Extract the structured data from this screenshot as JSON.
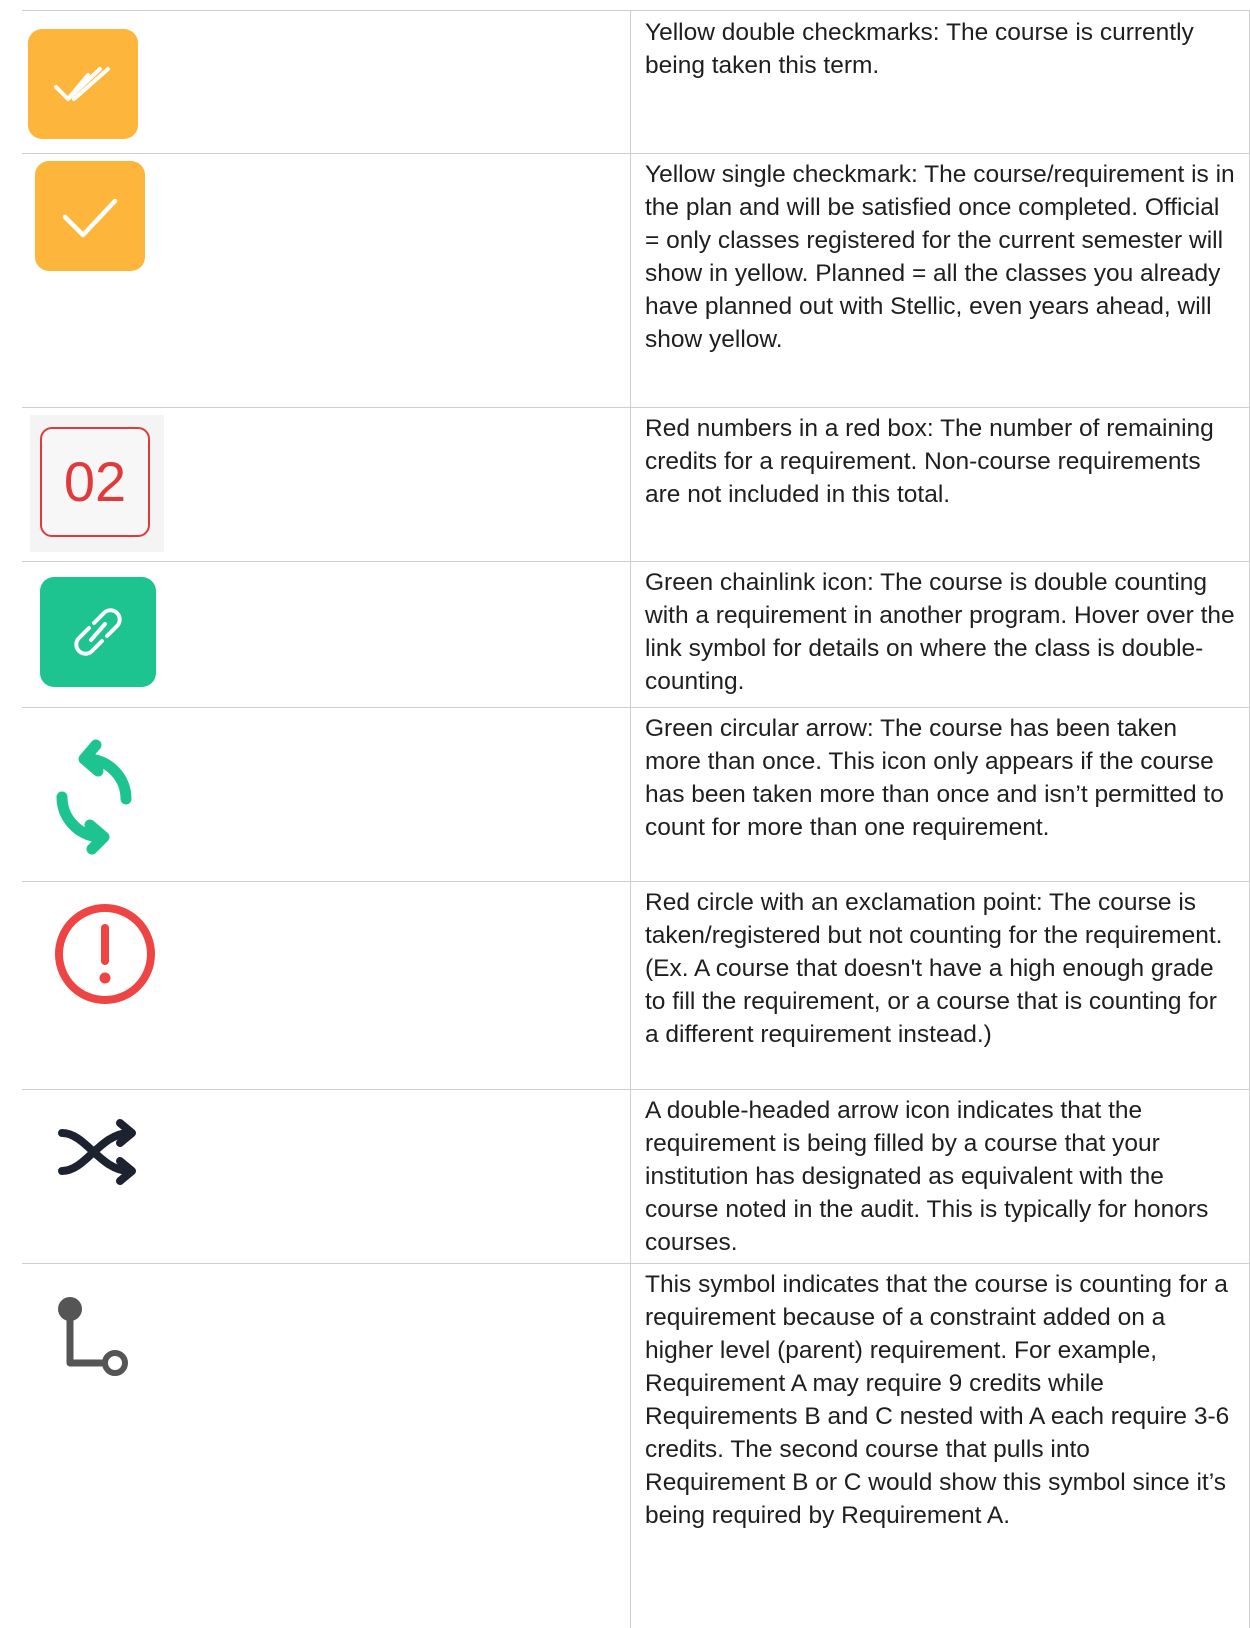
{
  "legend": {
    "rows": [
      {
        "icon": "double-check-icon",
        "color": "#FDB63B",
        "text": "Yellow double checkmarks: The course is currently being taken this term."
      },
      {
        "icon": "check-icon",
        "color": "#FDB63B",
        "text": "Yellow single checkmark: The course/requirement is in the plan and will be satisfied once completed. Official = only classes registered for the current semester will show in yellow. Planned = all the classes you already have planned out with Stellic, even years ahead, will show yellow."
      },
      {
        "icon": "remaining-credits-badge",
        "color": "#E03A3A",
        "badge_text": "02",
        "text": "Red numbers in a red box: The number of remaining credits for a requirement. Non-course requirements are not included in this total."
      },
      {
        "icon": "chain-link-icon",
        "color": "#1DC48F",
        "text": "Green chainlink icon: The course is double counting with a requirement in another program. Hover over the link symbol for details on where the class is double-counting."
      },
      {
        "icon": "circular-arrows-icon",
        "color": "#1DC48F",
        "text": "Green circular arrow: The course has been taken more than once. This icon only appears if the course has been taken more than once and isn’t permitted to count for more than one requirement."
      },
      {
        "icon": "exclamation-circle-icon",
        "color": "#EF4444",
        "text": "Red circle with an exclamation point: The course is taken/registered but not counting for the requirement. (Ex. A course that doesn't have a high enough grade to fill the requirement, or a course that is counting for a different requirement instead.)"
      },
      {
        "icon": "shuffle-arrows-icon",
        "color": "#1C2230",
        "text": "A double-headed arrow icon indicates that the requirement is being filled by a course that your institution has designated as equivalent with the course noted in the audit. This is typically for honors courses."
      },
      {
        "icon": "parent-constraint-icon",
        "color": "#555555",
        "text": "This symbol indicates that the course is counting for a requirement because of a constraint added on a higher level (parent) requirement. For example, Requirement A may require 9 credits while Requirements B and C nested with A each require 3-6 credits. The second course that pulls into Requirement B or C would show this symbol since it’s being required by Requirement A."
      }
    ]
  }
}
